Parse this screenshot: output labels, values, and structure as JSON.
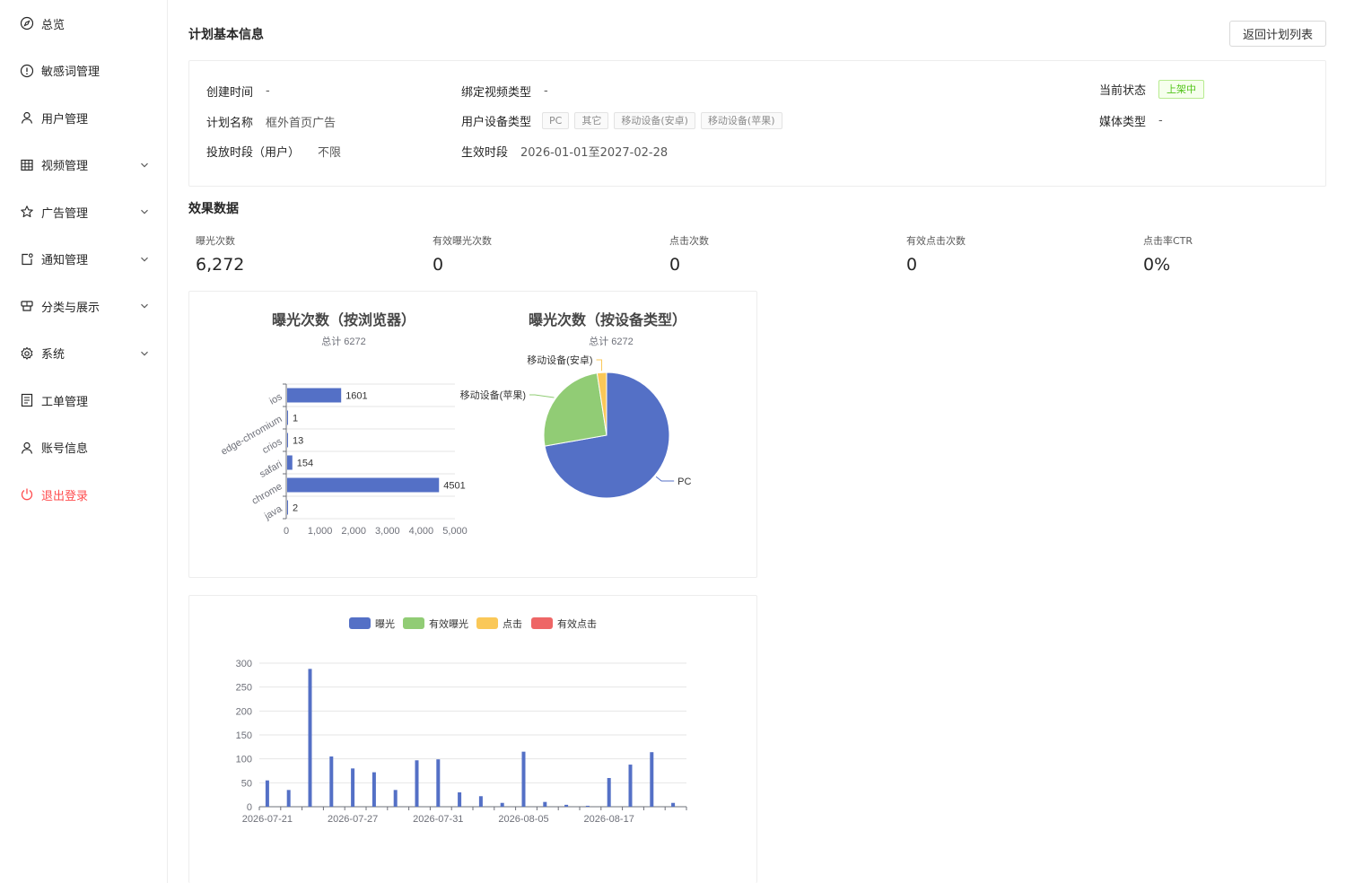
{
  "sidebar": {
    "items": [
      {
        "label": "总览",
        "icon": "compass-icon",
        "expandable": false
      },
      {
        "label": "敏感词管理",
        "icon": "alert-circle-icon",
        "expandable": false
      },
      {
        "label": "用户管理",
        "icon": "user-icon",
        "expandable": false
      },
      {
        "label": "视频管理",
        "icon": "grid-table-icon",
        "expandable": true
      },
      {
        "label": "广告管理",
        "icon": "star-icon",
        "expandable": true
      },
      {
        "label": "通知管理",
        "icon": "notification-icon",
        "expandable": true
      },
      {
        "label": "分类与展示",
        "icon": "category-icon",
        "expandable": true
      },
      {
        "label": "系统",
        "icon": "gear-icon",
        "expandable": true
      },
      {
        "label": "工单管理",
        "icon": "document-icon",
        "expandable": false
      },
      {
        "label": "账号信息",
        "icon": "user-icon",
        "expandable": false
      },
      {
        "label": "退出登录",
        "icon": "power-icon",
        "expandable": false
      }
    ]
  },
  "header": {
    "title": "计划基本信息",
    "back_label": "返回计划列表"
  },
  "info": {
    "created_label": "创建时间",
    "created_value": "-",
    "plan_name_label": "计划名称",
    "plan_name_value": "框外首页广告",
    "period_user_label": "投放时段（用户）",
    "period_user_value": "不限",
    "video_type_label": "绑定视频类型",
    "video_type_value": "-",
    "device_type_label": "用户设备类型",
    "device_tags": [
      "PC",
      "其它",
      "移动设备(安卓)",
      "移动设备(苹果)"
    ],
    "effective_label": "生效时段",
    "effective_value": "2026-01-01至2027-02-28",
    "status_label": "当前状态",
    "status_value": "上架中",
    "media_type_label": "媒体类型",
    "media_type_value": "-"
  },
  "effect": {
    "title": "效果数据",
    "stats": [
      {
        "label": "曝光次数",
        "value": "6,272"
      },
      {
        "label": "有效曝光次数",
        "value": "0"
      },
      {
        "label": "点击次数",
        "value": "0"
      },
      {
        "label": "有效点击次数",
        "value": "0"
      },
      {
        "label": "点击率CTR",
        "value": "0%"
      }
    ]
  },
  "colors": {
    "blue": "#5470c6",
    "green": "#91cc75",
    "yellow": "#fac858",
    "red": "#ee6666",
    "success": "#52c41a",
    "danger": "#ff4d4f"
  },
  "chart_data": [
    {
      "type": "bar",
      "orientation": "horizontal",
      "title": "曝光次数（按浏览器）",
      "subtitle": "总计 6272",
      "categories": [
        "ios",
        "edge-chromium",
        "crios",
        "safari",
        "chrome",
        "java"
      ],
      "values": [
        1601,
        1,
        13,
        154,
        4501,
        2
      ],
      "xlim": [
        0,
        5000
      ],
      "xticks": [
        "0",
        "1,000",
        "2,000",
        "3,000",
        "4,000",
        "5,000"
      ],
      "grid": true
    },
    {
      "type": "pie",
      "title": "曝光次数（按设备类型）",
      "subtitle": "总计 6272",
      "slices": [
        {
          "label": "PC",
          "value": 4530
        },
        {
          "label": "移动设备(苹果)",
          "value": 1590
        },
        {
          "label": "移动设备(安卓)",
          "value": 152
        }
      ]
    },
    {
      "type": "bar",
      "legend_position": "top-center",
      "series": [
        {
          "name": "曝光",
          "values": [
            55,
            35,
            288,
            105,
            80,
            72,
            35,
            97,
            99,
            30,
            22,
            8,
            115,
            10,
            4,
            2,
            60,
            88,
            114,
            8
          ]
        },
        {
          "name": "有效曝光",
          "values": [
            0,
            0,
            0,
            0,
            0,
            0,
            0,
            0,
            0,
            0,
            0,
            0,
            0,
            0,
            0,
            0,
            0,
            0,
            0,
            0
          ]
        },
        {
          "name": "点击",
          "values": [
            0,
            0,
            0,
            0,
            0,
            0,
            0,
            0,
            0,
            0,
            0,
            0,
            0,
            0,
            0,
            0,
            0,
            0,
            0,
            0
          ]
        },
        {
          "name": "有效点击",
          "values": [
            0,
            0,
            0,
            0,
            0,
            0,
            0,
            0,
            0,
            0,
            0,
            0,
            0,
            0,
            0,
            0,
            0,
            0,
            0,
            0
          ]
        }
      ],
      "x_tick_labels": [
        "2026-07-21",
        "2026-07-27",
        "2026-07-31",
        "2026-08-05",
        "2026-08-17"
      ],
      "x_tick_every": 4,
      "ylim": [
        0,
        300
      ],
      "yticks": [
        "0",
        "50",
        "100",
        "150",
        "200",
        "250",
        "300"
      ],
      "grid": true
    }
  ]
}
